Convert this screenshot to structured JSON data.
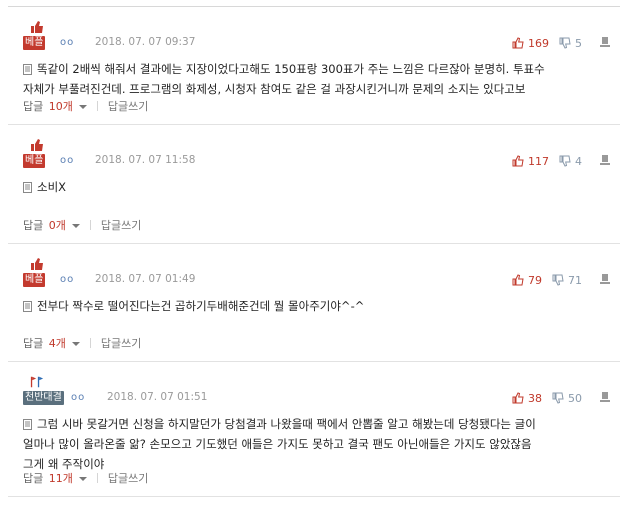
{
  "comments": [
    {
      "badge": "베플",
      "badge_style": "red",
      "rank": "oo",
      "date": "2018. 07. 07 09:37",
      "up": "169",
      "down": "5",
      "lines": [
        "똑같이 2배씩 해줘서 결과에는 지장이었다고해도 150표랑 300표가 주는 느낌은 다르잖아 분명히. 투표수",
        "자체가 부풀려진건데. 프로그램의 화제성, 시청자 참여도 같은 걸 과장시킨거니까 문제의 소지는 있다고보"
      ],
      "reply_label": "답글",
      "reply_count": "10개",
      "write_label": "답글쓰기"
    },
    {
      "badge": "베플",
      "badge_style": "red",
      "rank": "oo",
      "date": "2018. 07. 07 11:58",
      "up": "117",
      "down": "4",
      "lines": [
        "소비X"
      ],
      "reply_label": "답글",
      "reply_count": "0개",
      "write_label": "답글쓰기"
    },
    {
      "badge": "베플",
      "badge_style": "red",
      "rank": "oo",
      "date": "2018. 07. 07 01:49",
      "up": "79",
      "down": "71",
      "lines": [
        "전부다 짝수로 떨어진다는건 곱하기두배해준건데 뭘 몰아주기야^-^"
      ],
      "reply_label": "답글",
      "reply_count": "4개",
      "write_label": "답글쓰기"
    },
    {
      "badge": "천반대결",
      "badge_style": "gray",
      "rank": "oo",
      "date": "2018. 07. 07 01:51",
      "up": "38",
      "down": "50",
      "lines": [
        "그럼 시바 못갈거면 신청을 하지말던가 당첨결과 나왔을때 팩에서 안뽑줄 알고 해봤는데 당청됐다는 글이",
        "얼마나 많이 올라온줄 앎? 손모으고 기도했던 애들은 가지도 못하고 결국 팬도 아닌애들은 가지도 않았잖음",
        "그게 왜 주작이야"
      ],
      "reply_label": "답글",
      "reply_count": "11개",
      "write_label": "답글쓰기"
    }
  ],
  "colors": {
    "accent_red": "#c0392b",
    "badge_red": "#c33a2e",
    "badge_gray": "#5a6f7d",
    "rank_blue": "#5a7fb3"
  },
  "icons": {
    "up": "thumbs-up-icon",
    "down": "thumbs-down-icon",
    "report": "report-icon",
    "doc": "document-icon"
  }
}
